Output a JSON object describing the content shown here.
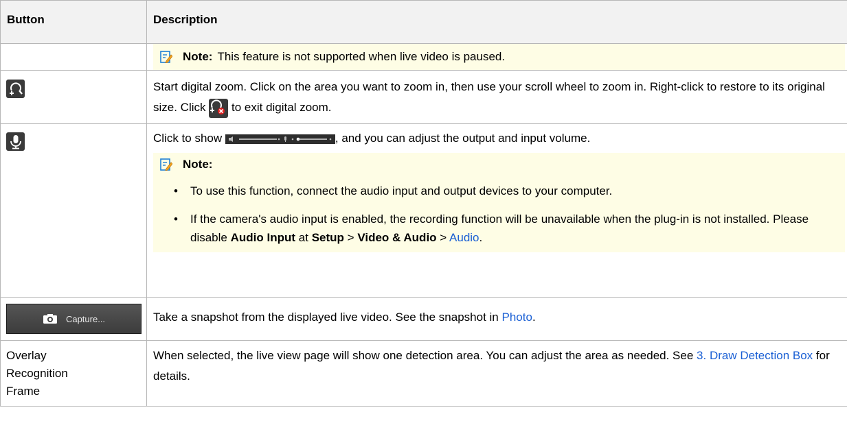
{
  "header": {
    "col1": "Button",
    "col2": "Description"
  },
  "row_pause_note": {
    "note_label": "Note:",
    "note_text": "This feature is not supported when live video is paused."
  },
  "row_zoom": {
    "icon": "digital-zoom-icon",
    "text_part1": "Start digital zoom. Click on the area you want to zoom in, then use your scroll wheel to zoom in. Right-click to restore to its original size. Click",
    "exit_icon": "exit-digital-zoom-icon",
    "text_part2": "to exit digital zoom."
  },
  "row_audio": {
    "icon": "microphone-icon",
    "text_part1": "Click to show",
    "slider_icon": "volume-slider-icon",
    "text_part2": ", and you can adjust the output and input volume.",
    "note_label": "Note:",
    "bullet1": "To use this function, connect the audio input and output devices to your computer.",
    "bullet2_part1": "If the camera's audio input is enabled, the recording function will be unavailable when the plug-in is not installed. Please disable",
    "bullet2_bold1": "Audio Input",
    "bullet2_at": "at",
    "bullet2_bold2": "Setup",
    "bullet2_sep": ">",
    "bullet2_bold3": "Video & Audio",
    "bullet2_sep2": ">",
    "bullet2_link": "Audio",
    "bullet2_end": "."
  },
  "row_capture": {
    "button_label": "Capture...",
    "text": "Take a snapshot from the displayed live video. See the snapshot in",
    "link": "Photo",
    "end": "."
  },
  "row_overlay": {
    "button_text": "Overlay Recognition Frame",
    "text_part1": "When selected, the live view page will show one detection area. You can adjust the area as needed. See",
    "link": "3. Draw Detection Box",
    "text_part2": "for details."
  },
  "colors": {
    "note_bg": "#fefde5",
    "link": "#1a5fd4",
    "header_bg": "#f2f2f2",
    "border": "#b7b7b7"
  }
}
